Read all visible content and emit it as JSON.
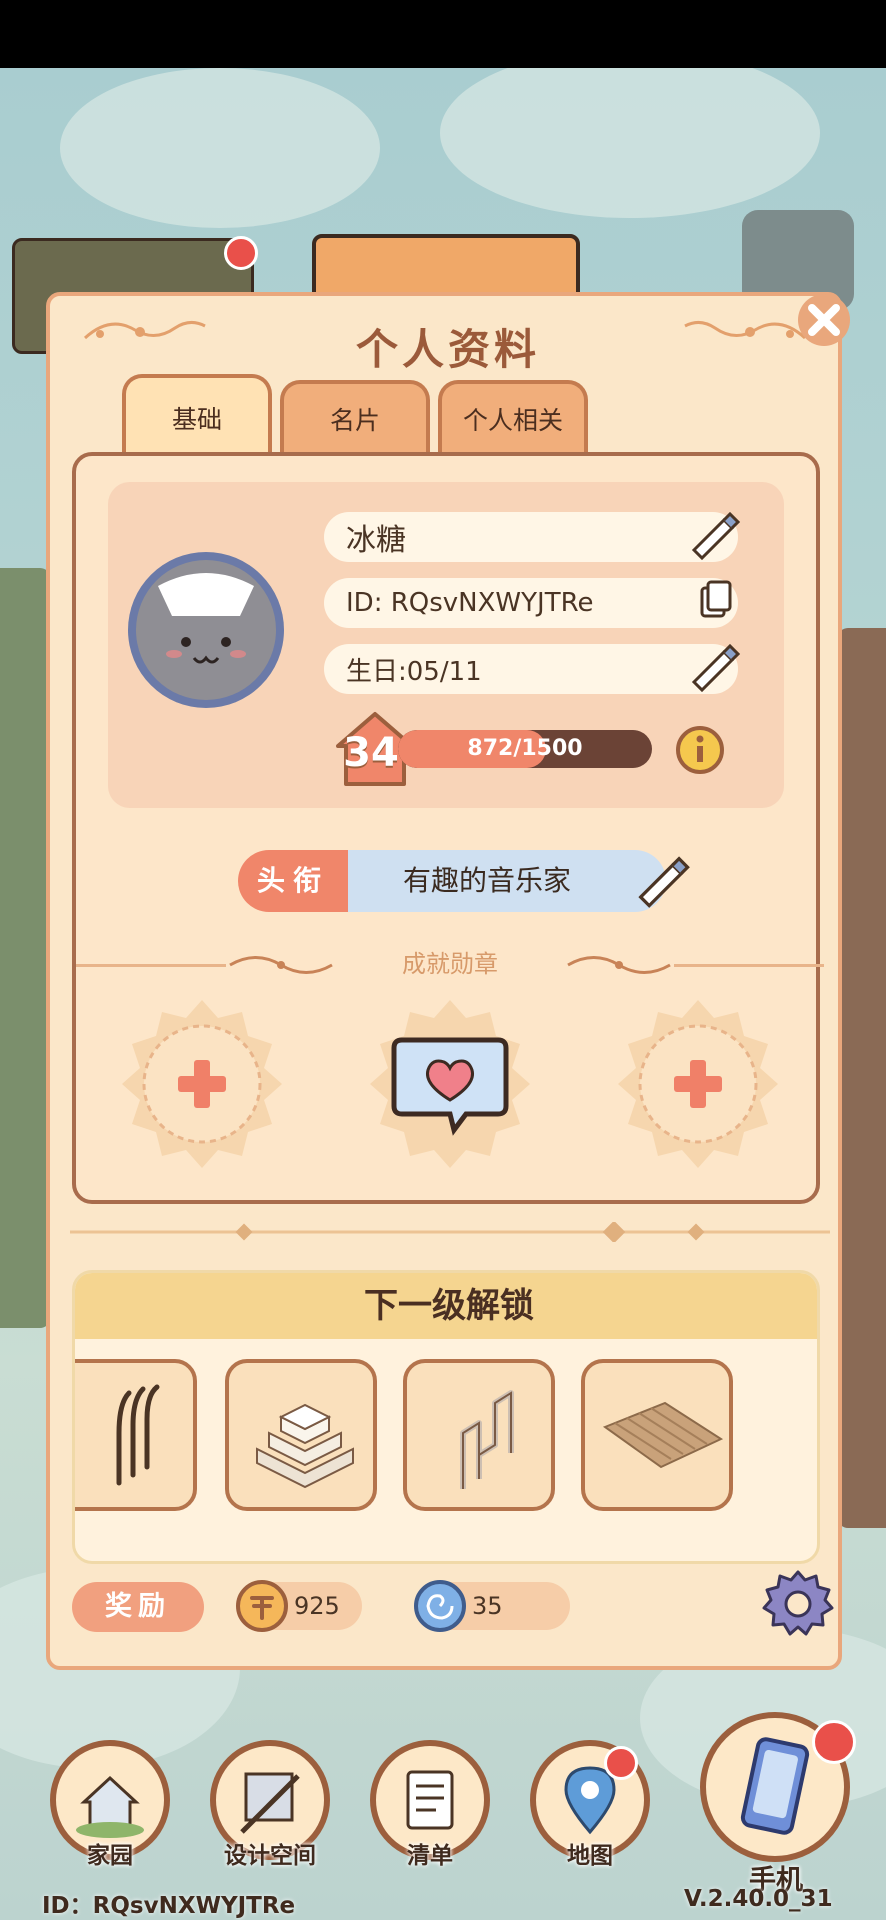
{
  "dialog": {
    "title": "个人资料",
    "tabs": [
      {
        "label": "基础",
        "active": true
      },
      {
        "label": "名片",
        "active": false
      },
      {
        "label": "个人相关",
        "active": false
      }
    ]
  },
  "profile": {
    "name": "冰糖",
    "id_text": "ID: RQsvNXWYJTRe",
    "birthday": "生日:05/11",
    "level": "34",
    "xp_text": "872/1500",
    "xp_current": 872,
    "xp_max": 1500,
    "title_label": "头衔",
    "title_value": "有趣的音乐家"
  },
  "achievements": {
    "heading": "成就勋章",
    "slots": [
      "plus-icon",
      "heart-speech-bubble-badge",
      "plus-icon"
    ]
  },
  "next_level": {
    "heading": "下一级解锁",
    "items": [
      "railing-item",
      "stairs-item",
      "fence-item",
      "straw-mat-item"
    ]
  },
  "reward": {
    "label": "奖励",
    "coins": "925",
    "gems": "35"
  },
  "bottom_nav": {
    "items": [
      {
        "label": "家园",
        "icon": "house-icon"
      },
      {
        "label": "设计空间",
        "icon": "ruler-icon"
      },
      {
        "label": "清单",
        "icon": "list-icon"
      },
      {
        "label": "地图",
        "icon": "map-pin-icon"
      },
      {
        "label": "手机",
        "icon": "phone-icon"
      }
    ],
    "footer_id": "ID：RQsvNXWYJTRe",
    "version": "V.2.40.0_31"
  },
  "colors": {
    "panel": "#fbe7c9",
    "border": "#e9a77c",
    "accent_orange": "#f0866a",
    "brown": "#9c5f3d"
  }
}
